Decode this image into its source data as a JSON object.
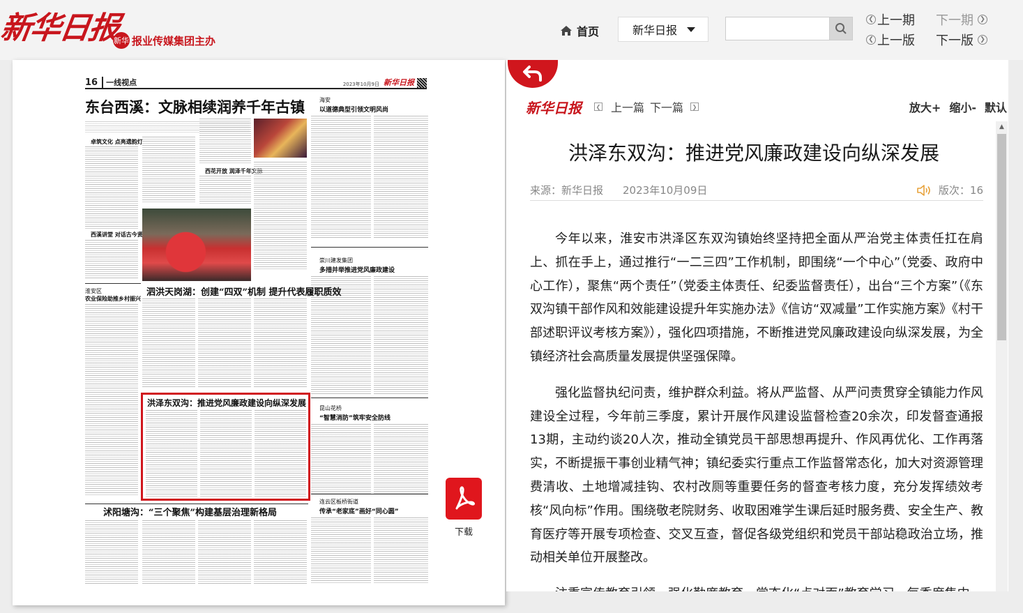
{
  "header": {
    "logo_text": "新华日报",
    "sub_seal": "新华",
    "sub_text": "报业传媒集团主办",
    "home_label": "首页",
    "paper_select": "新华日报",
    "search_placeholder": "",
    "prev_issue": "上一期",
    "next_issue": "下一期",
    "prev_page": "上一版",
    "next_page": "下一版"
  },
  "newspaper": {
    "page_number": "16",
    "section": "一线视点",
    "date": "2023年10月9日",
    "mini_logo": "新华日报",
    "headlines": {
      "main": "东台西溪：文脉相续润养千年古镇",
      "main_sub_1": "卓筑文化 点亮遗韵灯",
      "main_sub_2": "西溪讲堂 对话古今贤",
      "col_right_loc": "海安",
      "col_right_title": "以道德典型引领文明风尚",
      "left_loc": "淮安区",
      "left_title": "农业保险助推乡村振兴",
      "mid_title": "泗洪天岗湖：创建“四双”机制 提升代表履职质效",
      "mid_sub": "西花开放 润泽千年文脉",
      "right2_loc": "崇川建发集团",
      "right2_title": "多措并举推进党风廉政建设",
      "highlight": "洪泽东双沟：推进党风廉政建设向纵深发展",
      "right3_loc": "昆山花桥",
      "right3_title": "“智慧消防”筑牢安全防线",
      "bottom_title": "沭阳塘沟：“三个聚焦”构建基层治理新格局",
      "right4_loc": "连云区板桥街道",
      "right4_title": "传承“老家底”画好“同心圆”"
    },
    "download_label": "下载"
  },
  "article": {
    "logo": "新华日报",
    "prev_article": "上一篇",
    "next_article": "下一篇",
    "zoom_in": "放大+",
    "zoom_out": "缩小-",
    "zoom_default": "默认",
    "title": "洪泽东双沟：推进党风廉政建设向纵深发展",
    "source": "来源：新华日报",
    "date": "2023年10月09日",
    "edition": "版次：16",
    "paragraphs": [
      "今年以来，淮安市洪泽区东双沟镇始终坚持把全面从严治党主体责任扛在肩上、抓在手上，通过推行“一二三四”工作机制，即围绕“一个中心”（党委、政府中心工作），聚焦“两个责任”（党委主体责任、纪委监督责任），出台“三个方案”（《东双沟镇干部作风和效能建设提升年实施办法》《信访“双减量”工作实施方案》《村干部述职评议考核方案》），强化四项措施，不断推进党风廉政建设向纵深发展，为全镇经济社会高质量发展提供坚强保障。",
      "强化监督执纪问责，维护群众利益。将从严监督、从严问责贯穿全镇能力作风建设全过程，今年前三季度，累计开展作风建设监督检查20余次，印发督查通报13期，主动约谈20人次，推动全镇党员干部思想再提升、作风再优化、工作再落实，不断提振干事创业精气神；镇纪委实行重点工作监督常态化，加大对资源管理费清收、土地增减挂钩、农村改厕等重要任务的督查考核力度，充分发挥绩效考核“风向标”作用。围绕敬老院财务、收取困难学生课后延时服务费、安全生产、教育医疗等开展专项检查、交叉互查，督促各级党组织和党员干部站稳政治立场，推动相关单位开展整改。",
      "注重宣传教育引领，强化勤廉教育。常态化“点对面”教育学习，每季度集中"
    ],
    "colors": {
      "brand_red": "#c8161d",
      "highlight_red": "#d0161d"
    }
  }
}
